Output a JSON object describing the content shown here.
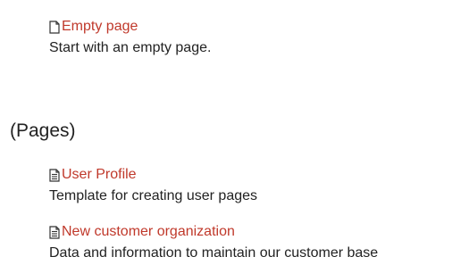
{
  "templates_top": [
    {
      "name": "Empty page",
      "description": "Start with an empty page.",
      "icon": "blank-page-icon"
    }
  ],
  "section": {
    "title": "(Pages)"
  },
  "templates_pages": [
    {
      "name": "User Profile",
      "description": "Template for creating user pages",
      "icon": "document-icon"
    },
    {
      "name": "New customer organization",
      "description": "Data and information to maintain our customer base",
      "icon": "document-icon"
    }
  ],
  "colors": {
    "link": "#c0392b",
    "text": "#222222"
  }
}
